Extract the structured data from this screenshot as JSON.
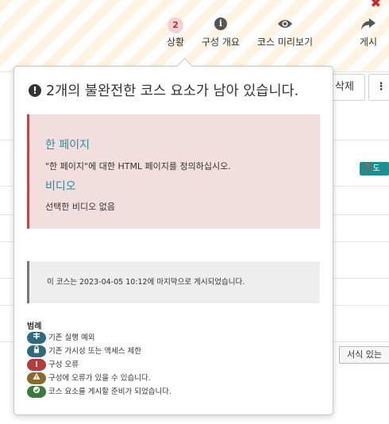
{
  "toolbar": {
    "items": [
      {
        "label": "상황",
        "badge": "2"
      },
      {
        "label": "구성 개요",
        "icon": "info-icon"
      },
      {
        "label": "코스 미리보기",
        "icon": "eye-icon"
      },
      {
        "label": "게시",
        "icon": "share-icon"
      }
    ],
    "close": "✖"
  },
  "background": {
    "delete_label": "삭제",
    "more_label": "⋮",
    "help_chip": "❓도움",
    "format_label": "서식 있는"
  },
  "popover": {
    "title": "2개의 불완전한 코스 요소가 남아 있습니다.",
    "issues": [
      {
        "title": "한 페이지",
        "text": "\"한 페이지\"에 대한 HTML 페이지를 정의하십시오."
      },
      {
        "title": "비디오",
        "text": "선택한 비디오 없음"
      }
    ],
    "published_note": "이 코스는 2023-04-05 10:12에 마지막으로 게시되었습니다.",
    "legend": {
      "title": "범례",
      "items": [
        {
          "label": "기존 실행 예외",
          "icon": "exception-icon",
          "color": "#2f6b7f"
        },
        {
          "label": "기존 가시성 또는 액세스 제한",
          "icon": "lock-icon",
          "color": "#2f6b7f"
        },
        {
          "label": "구성 오류",
          "icon": "error-icon",
          "color": "#b23b3b"
        },
        {
          "label": "구성에 오류가 있을 수 있습니다.",
          "icon": "warning-icon",
          "color": "#8a6a2a"
        },
        {
          "label": "코스 요소를 게시할 준비가 되었습니다.",
          "icon": "check-icon",
          "color": "#3a7a3a"
        }
      ]
    }
  },
  "colors": {
    "accent": "#2a8f95",
    "issue_bg": "#f2dede",
    "issue_border": "#b94a48"
  }
}
